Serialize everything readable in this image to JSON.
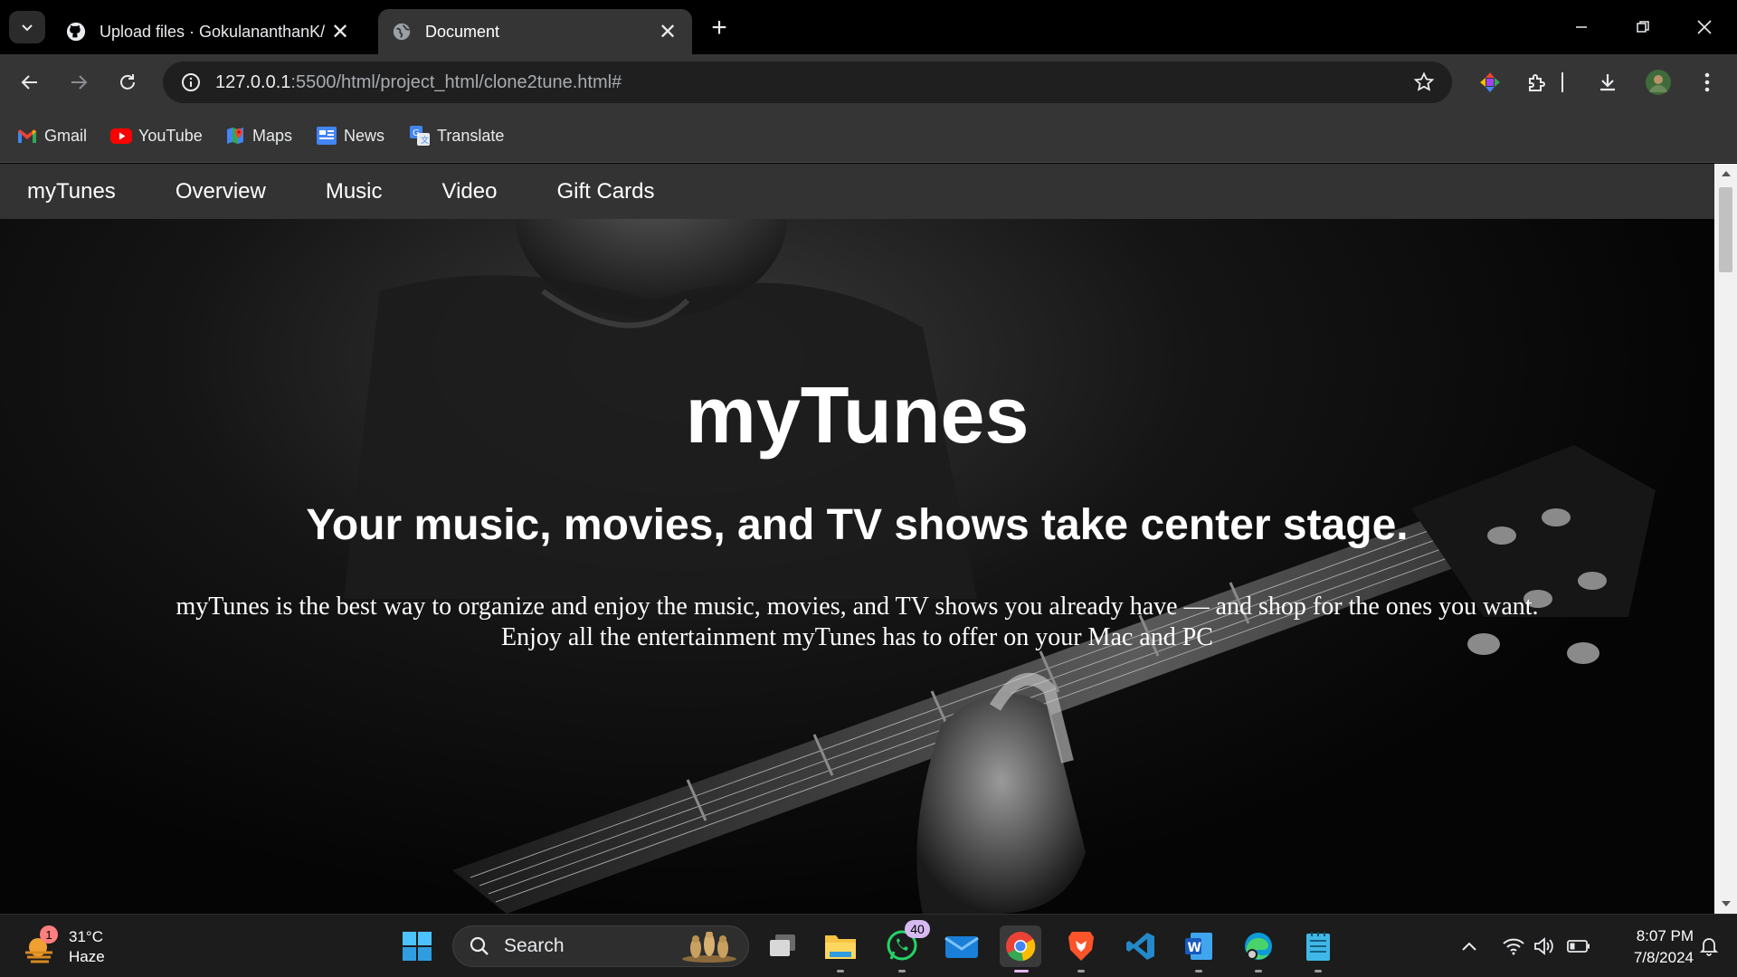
{
  "browser": {
    "tabs": [
      {
        "title": "Upload files · GokulananthanK/",
        "favicon": "github-icon",
        "active": false
      },
      {
        "title": "Document",
        "favicon": "globe-icon",
        "active": true
      }
    ],
    "url_host": "127.0.0.1",
    "url_rest": ":5500/html/project_html/clone2tune.html#",
    "bookmarks": [
      {
        "label": "Gmail",
        "icon": "gmail-icon"
      },
      {
        "label": "YouTube",
        "icon": "youtube-icon"
      },
      {
        "label": "Maps",
        "icon": "maps-icon"
      },
      {
        "label": "News",
        "icon": "news-icon"
      },
      {
        "label": "Translate",
        "icon": "translate-icon"
      }
    ]
  },
  "site": {
    "nav": [
      "myTunes",
      "Overview",
      "Music",
      "Video",
      "Gift Cards"
    ],
    "hero_title": "myTunes",
    "hero_subtitle": "Your music, movies, and TV shows take center stage.",
    "hero_body_line1": "myTunes is the best way to organize and enjoy the music, movies, and TV shows you already have — and shop for the ones you want.",
    "hero_body_line2": "Enjoy all the entertainment myTunes has to offer on your Mac and PC"
  },
  "taskbar": {
    "weather_temp": "31°C",
    "weather_desc": "Haze",
    "weather_badge": "1",
    "search_label": "Search",
    "whatsapp_badge": "40",
    "time": "8:07 PM",
    "date": "7/8/2024"
  },
  "colors": {
    "page_bg": "#000000",
    "site_nav_bg": "#333333",
    "browser_toolbar": "#353535"
  }
}
